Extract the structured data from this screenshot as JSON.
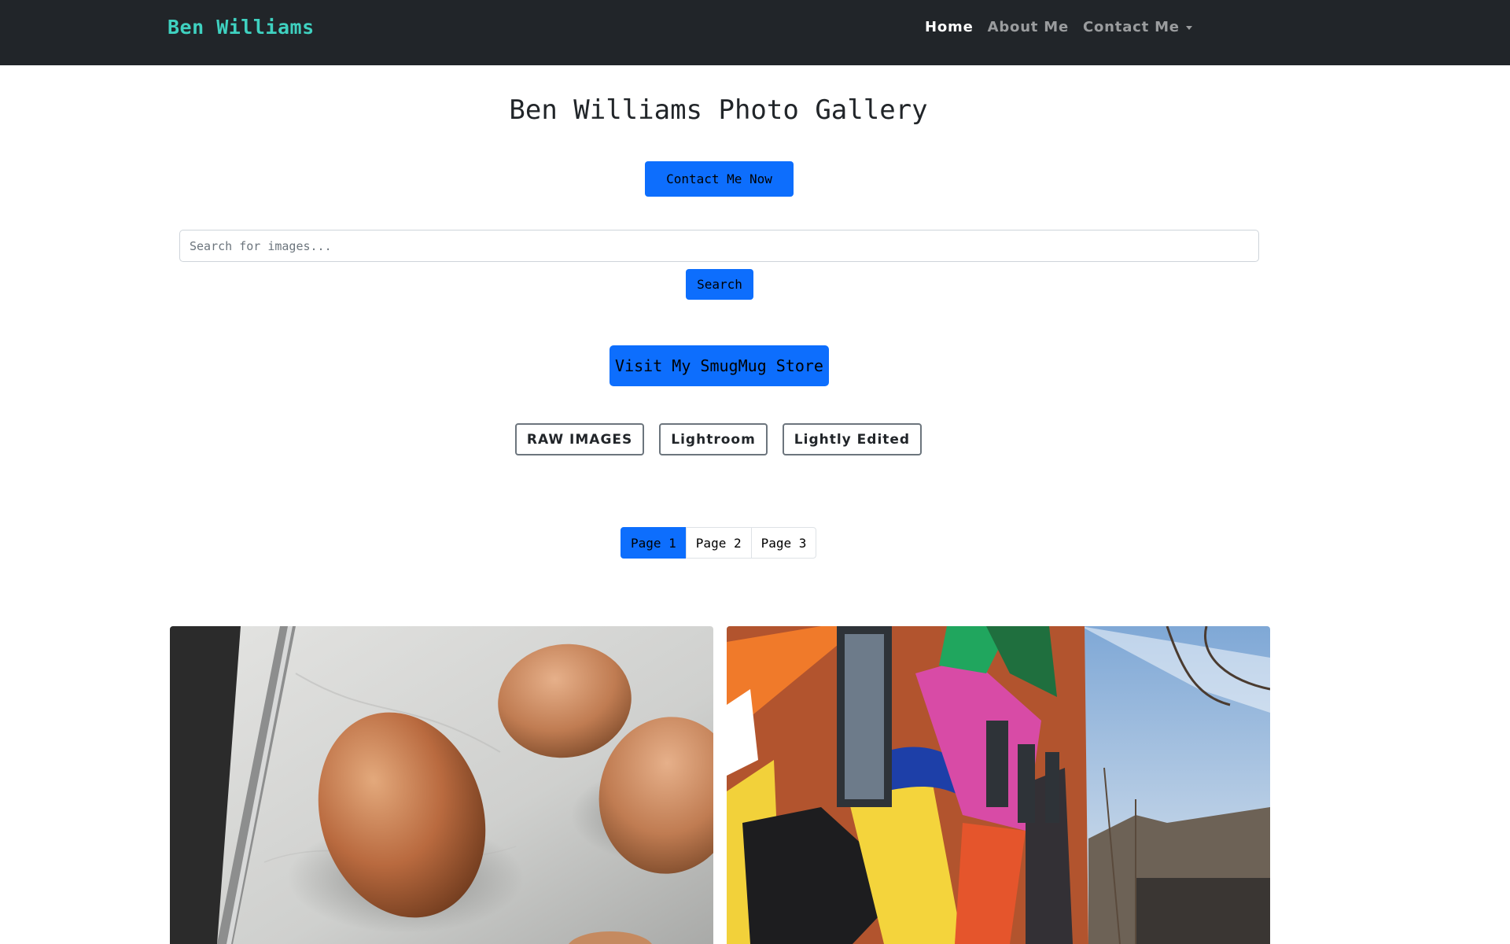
{
  "navbar": {
    "brand": "Ben Williams",
    "links": [
      {
        "label": "Home"
      },
      {
        "label": "About Me"
      },
      {
        "label": "Contact Me"
      }
    ]
  },
  "main": {
    "title": "Ben Williams Photo Gallery",
    "contact_button": "Contact Me Now",
    "search": {
      "placeholder": "Search for images...",
      "button": "Search"
    },
    "store_button": "Visit My SmugMug Store",
    "filters": [
      "RAW IMAGES",
      "Lightroom",
      "Lightly Edited"
    ],
    "pagination": {
      "pages": [
        "Page 1",
        "Page 2",
        "Page 3"
      ],
      "current": "Page 1"
    },
    "photos": [
      {
        "subject": "eggs-on-marble-photo"
      },
      {
        "subject": "mural-brick-building-photo"
      }
    ]
  },
  "colors": {
    "navbar_bg": "#212529",
    "brand": "#3fd1c0",
    "primary": "#0d6efd"
  }
}
